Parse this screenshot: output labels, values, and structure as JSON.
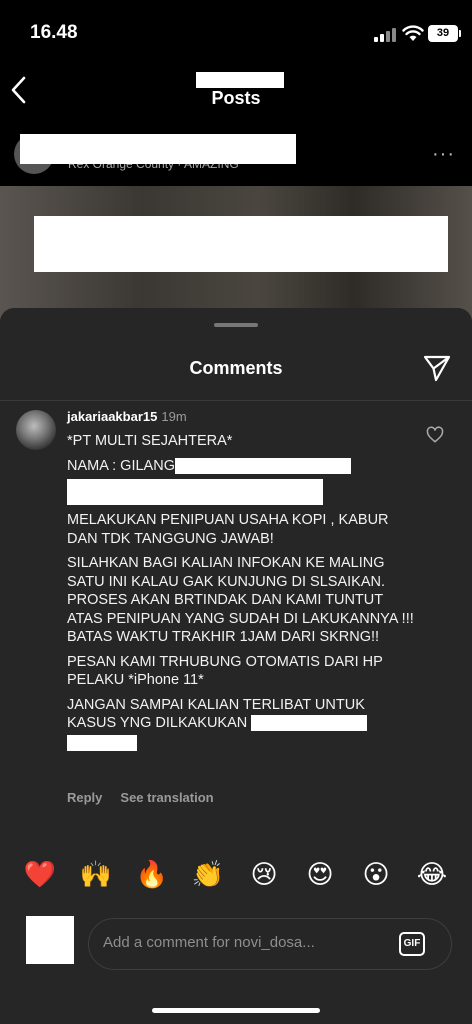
{
  "status_bar": {
    "time": "16.48",
    "battery": "39"
  },
  "header": {
    "title": "Posts"
  },
  "post": {
    "music": "Rex Orange County · AMAZING",
    "more": "···"
  },
  "sheet": {
    "title": "Comments"
  },
  "comment": {
    "username": "jakariaakbar15",
    "time": "19m",
    "lines": [
      "*PT MULTI SEJAHTERA*",
      "NAMA : GILANG ",
      "MELAKUKAN PENIPUAN USAHA KOPI , KABUR DAN TDK TANGGUNG JAWAB!",
      "SILAHKAN BAGI KALIAN INFOKAN KE MALING SATU INI KALAU GAK KUNJUNG DI SLSAIKAN. PROSES AKAN BRTINDAK DAN KAMI TUNTUT ATAS PENIPUAN YANG SUDAH DI LAKUKANNYA !!! BATAS WAKTU TRAKHIR 1JAM DARI SKRNG!!",
      "PESAN KAMI TRHUBUNG OTOMATIS DARI HP PELAKU *iPhone 11*",
      "JANGAN SAMPAI KALIAN TERLIBAT UNTUK KASUS YNG DILKAKUKAN "
    ],
    "reply_label": "Reply",
    "translate_label": "See translation"
  },
  "emojis": [
    "❤️",
    "🙌",
    "🔥",
    "👏",
    "😢",
    "😍",
    "😮",
    "😂"
  ],
  "input": {
    "placeholder": "Add a comment for novi_dosa...",
    "gif_label": "GIF"
  }
}
